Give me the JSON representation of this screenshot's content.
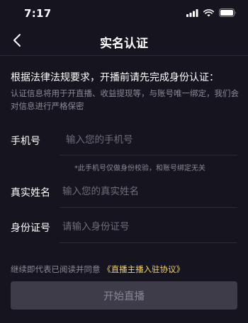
{
  "status_bar": {
    "time": "7:17",
    "icons": [
      "signal-icon",
      "wifi-icon",
      "battery-icon"
    ]
  },
  "header": {
    "back_icon": "chevron-left-icon",
    "title": "实名认证"
  },
  "intro": {
    "title": "根据法律法规要求，开播前请先完成身份认证：",
    "description": "认证信息将用于开直播、收益提现等，与账号唯一绑定，我们会对信息进行严格保密"
  },
  "form": {
    "phone": {
      "label": "手机号",
      "value": "",
      "placeholder": "输入您的手机号",
      "note": "*此手机号仅做身份校验，和账号绑定无关"
    },
    "name": {
      "label": "真实姓名",
      "value": "",
      "placeholder": "输入您的真实姓名"
    },
    "id_number": {
      "label": "身份证号",
      "value": "",
      "placeholder": "请输入身份证号"
    }
  },
  "agreement": {
    "prefix": "继续即代表已阅读并同意",
    "link": "《直播主播入驻协议》"
  },
  "submit": {
    "label": "开始直播"
  },
  "colors": {
    "background": "#15141f",
    "link": "#f6d36b",
    "button_disabled": "#3d3c48"
  }
}
